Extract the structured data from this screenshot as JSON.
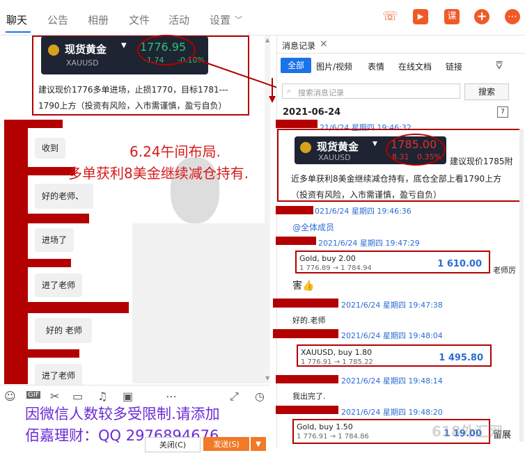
{
  "top_tabs": [
    "聊天",
    "公告",
    "相册",
    "文件",
    "活动",
    "设置"
  ],
  "settings_chevron": "﹀",
  "top_icons": {
    "call": "☏",
    "video": "▶",
    "lesson": "课",
    "add": "+",
    "more": "⋯"
  },
  "left_post": {
    "ticker": {
      "name": "现货黄金",
      "symbol": "XAUUSD",
      "price": "1776.95",
      "change": "-1.74",
      "pct": "-0.10%"
    },
    "line1": "建议现价1776多单进场，止损1770，目标1781---",
    "line2": "1790上方（投资有风险，入市需谨慎，盈亏自负）"
  },
  "chat_bubbles": [
    "收到",
    "好的老师、",
    "进场了",
    "进了老师",
    "好的  老师",
    "进了老师"
  ],
  "overlay": {
    "line1": "6.24午间布局.",
    "line2": "多单获利8美金继续减仓持有."
  },
  "toolbar_icons": [
    "☺",
    "GIF",
    "✂",
    "▭",
    "♫",
    "▣",
    "⋯",
    "⤢",
    "◷"
  ],
  "bottom_ad": {
    "line1": "因微信人数较多受限制.请添加",
    "line2": "佰嘉理财：QQ 2976894676"
  },
  "bottom_buttons": {
    "close": "关闭(C)",
    "send": "发送(S)"
  },
  "history": {
    "title": "消息记录",
    "close": "×",
    "filters": [
      "全部",
      "图片/视频",
      "表情",
      "在线文档",
      "链接"
    ],
    "search_placeholder": "搜索消息记录",
    "search_button": "搜索",
    "date": "2021-06-24",
    "msg1_time": "21/6/24 星期四 19:46:32",
    "ticker": {
      "name": "现货黄金",
      "symbol": "XAUUSD",
      "price": "1785.00",
      "change": "8.31",
      "pct": "0.35%"
    },
    "msg1_side": "建议现价1785附",
    "msg1_line2": "近多单获利8美金继续减仓持有，底仓全部上看1790上方",
    "msg1_line3": "（投资有风险，入市需谨慎，盈亏自负）",
    "msg2_time": "021/6/24 星期四 19:46:36",
    "mention": "@全体成员",
    "msg3_time": "2021/6/24 星期四 19:47:29",
    "card1": {
      "line1": "Gold, buy 2.00",
      "line2": "1 776.89 → 1 784.94",
      "value": "1 610.00"
    },
    "card1_side": "老师厉",
    "card1_after": "害👍",
    "msg4_time": "2021/6/24 星期四 19:47:38",
    "msg4_text": "好的.老师",
    "msg5_time": "2021/6/24 星期四 19:48:04",
    "card2": {
      "line1": "XAUUSD, buy 1.80",
      "line2": "1 776.91 → 1 785.22",
      "value": "1 495.80"
    },
    "msg6_time": "2021/6/24 星期四 19:48:14",
    "msg6_text": "我出完了.",
    "msg7_time": "2021/6/24 星期四 19:48:20",
    "card3": {
      "line1": "Gold, buy 1.50",
      "line2": "1 776.91 → 1 784.86",
      "value": "1 19.00"
    },
    "card3_side": "留展"
  },
  "watermark": "618外汇网",
  "colors": {
    "accent": "#1a73e8",
    "red": "#b30000",
    "orange": "#f05a28",
    "ticker_bg": "#1e2432",
    "up": "#e03030",
    "down": "#2ec27e"
  }
}
